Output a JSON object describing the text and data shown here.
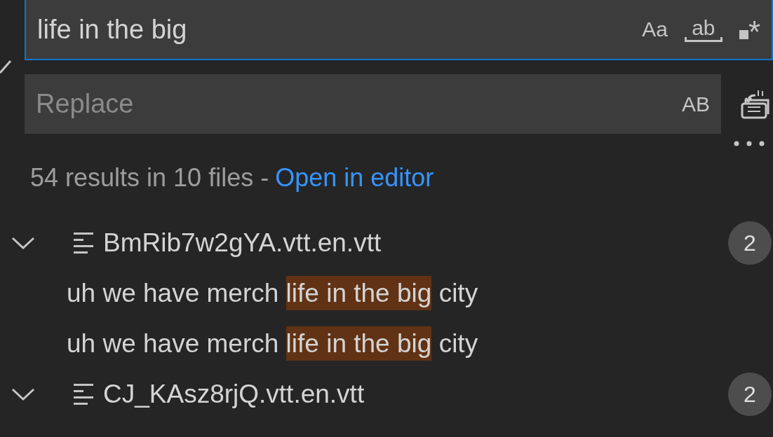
{
  "search": {
    "value": "life in the big",
    "options": [
      {
        "kind": "case",
        "label": "Aa"
      },
      {
        "kind": "word",
        "label": "ab"
      },
      {
        "kind": "regex",
        "label": "*"
      }
    ]
  },
  "replace": {
    "placeholder": "Replace",
    "options": [
      {
        "kind": "preserve",
        "label": "AB"
      }
    ]
  },
  "summary": {
    "text": "54 results in 10 files - ",
    "link": "Open in editor"
  },
  "files": [
    {
      "name": "BmRib7w2gYA.vtt.en.vtt",
      "count": "2",
      "expanded": true,
      "matches": [
        {
          "before": "uh we have merch ",
          "match": "life in the big",
          "after": " city"
        },
        {
          "before": "uh we have merch ",
          "match": "life in the big",
          "after": " city"
        }
      ]
    },
    {
      "name": "CJ_KAsz8rjQ.vtt.en.vtt",
      "count": "2",
      "expanded": true
    }
  ]
}
